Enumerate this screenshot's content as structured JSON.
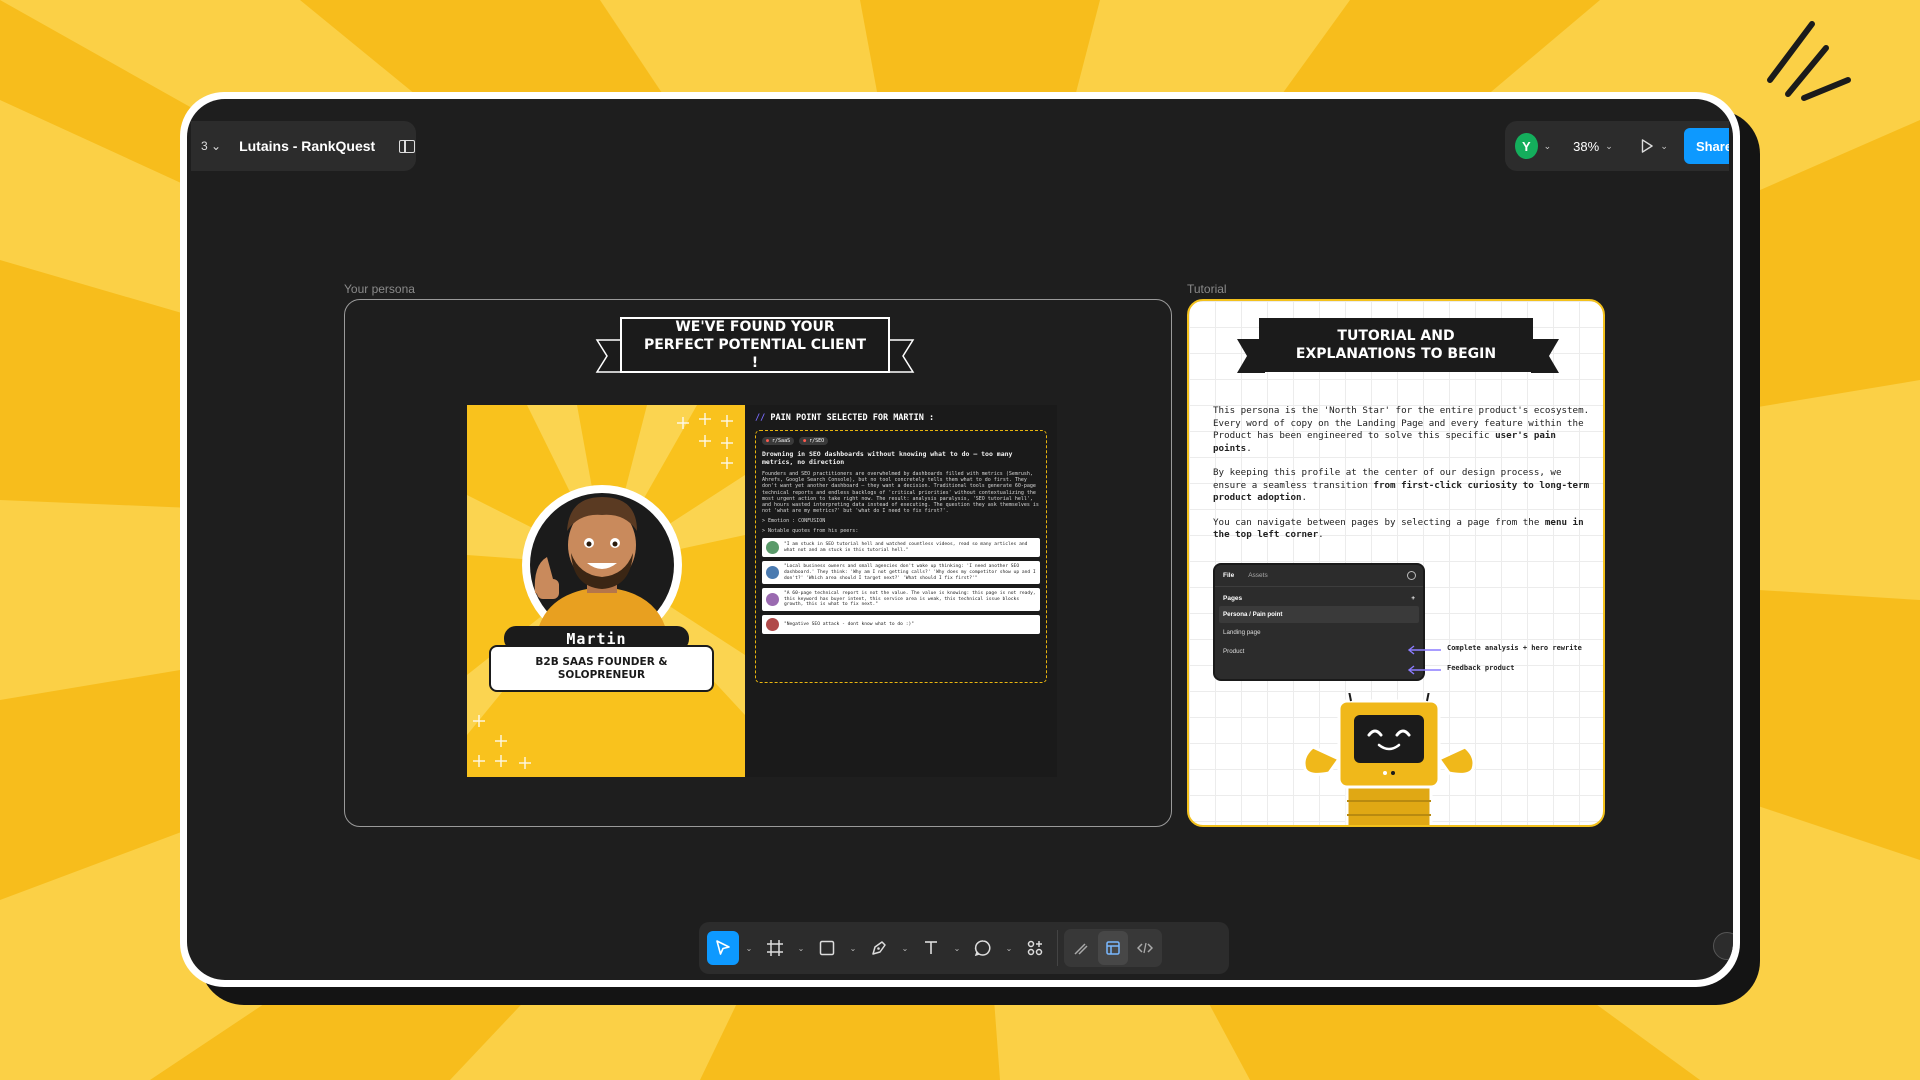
{
  "app": {
    "file_title": "Lutains - RankQuest",
    "menu_stub": "3",
    "user_initial": "Y",
    "zoom": "38%",
    "share_label": "Share"
  },
  "colors": {
    "background": "#f7bd1c",
    "canvas": "#1e1e1e",
    "accent_blue": "#0d99ff",
    "user_green": "#14ae5c",
    "persona_yellow": "#f9c21d"
  },
  "frames": {
    "persona_label": "Your persona",
    "tutorial_label": "Tutorial"
  },
  "persona": {
    "banner": "WE'VE FOUND YOUR PERFECT POTENTIAL CLIENT !",
    "name": "Martin",
    "role": "B2B SAAS FOUNDER & SOLOPRENEUR",
    "pain_title_prefix": "//",
    "pain_title": "PAIN POINT SELECTED FOR MARTIN :",
    "tags": [
      "r/SaaS",
      "r/SEO"
    ],
    "pain_headline": "Drowning in SEO dashboards without knowing what to do — too many metrics, no direction",
    "pain_body": "Founders and SEO practitioners are overwhelmed by dashboards filled with metrics (Semrush, Ahrefs, Google Search Console), but no tool concretely tells them what to do first. They don't want yet another dashboard — they want a decision. Traditional tools generate 60-page technical reports and endless backlogs of 'critical priorities' without contextualizing the most urgent action to take right now. The result: analysis paralysis, 'SEO tutorial hell', and hours wasted interpreting data instead of executing. The question they ask themselves is not 'what are my metrics?' but 'what do I need to fix first?'.",
    "emotion": "> Emotion : CONFUSION",
    "quotes_label": "> Notable quotes from his peers:",
    "quotes": [
      "\"I am stuck in SEO tutorial hell and watched countless videos, read so many articles and what not and am stuck in this tutorial hell.\"",
      "\"Local business owners and small agencies don't wake up thinking: 'I need another SEO dashboard.' They think: 'Why am I not getting calls?' 'Why does my competitor show up and I don't?' 'Which area should I target next?' 'What should I fix first?'\"",
      "\"A 60-page technical report is not the value. The value is knowing: this page is not ready, this keyword has buyer intent, this service area is weak, this technical issue blocks growth, this is what to fix next.\"",
      "\"Negative SEO attack - dont know what to do :)\""
    ]
  },
  "tutorial": {
    "banner": "TUTORIAL AND EXPLANATIONS TO BEGIN",
    "p1": "This persona is the 'North Star' for the entire product's ecosystem. Every word of copy on the Landing Page and every feature within the Product has been engineered to solve this specific ",
    "p1_bold": "user's pain points",
    "p1_end": ".",
    "p2": "By keeping this profile at the center of our design process, we ensure a seamless transition ",
    "p2_bold": "from first-click curiosity to long-term product adoption",
    "p2_end": ".",
    "p3": "You can navigate between pages by selecting a page from the ",
    "p3_bold": "menu in the top left corner",
    "p3_end": ".",
    "panel": {
      "tab_file": "File",
      "tab_assets": "Assets",
      "pages_label": "Pages",
      "add": "+",
      "items": [
        "Persona / Pain point",
        "Landing page",
        "Product"
      ]
    },
    "annotation_landing": "Complete analysis + hero rewrite",
    "annotation_product": "Feedback product"
  },
  "toolbar": {
    "tools": [
      "move-tool",
      "frame-tool",
      "rectangle-tool",
      "pen-tool",
      "text-tool",
      "comment-tool",
      "actions-tool"
    ],
    "dev_tools": [
      "draw-mode",
      "design-mode",
      "dev-mode"
    ]
  }
}
